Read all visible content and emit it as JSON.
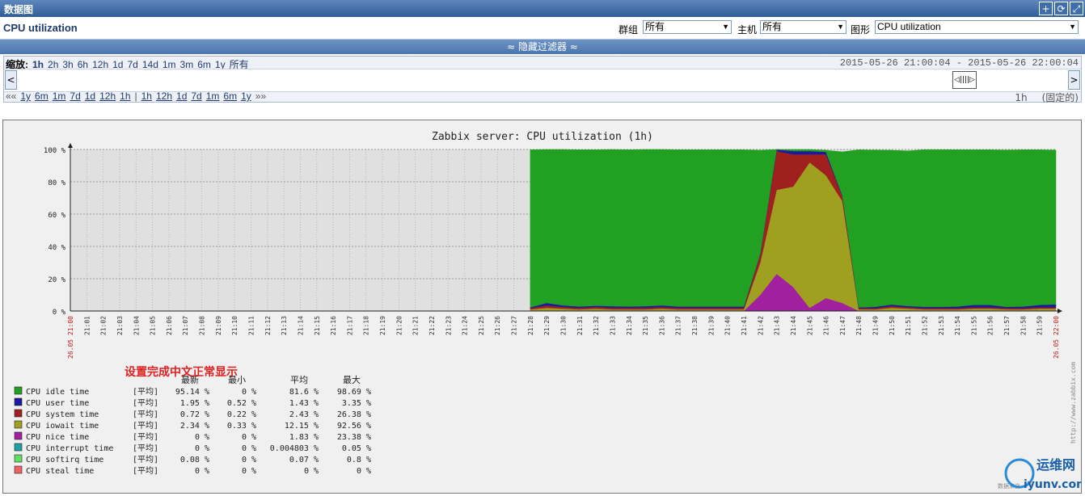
{
  "window": {
    "title": "数据图"
  },
  "header": {
    "page_title": "CPU utilization",
    "group_label": "群组",
    "group_value": "所有",
    "host_label": "主机",
    "host_value": "所有",
    "graph_label": "图形",
    "graph_value": "CPU utilization"
  },
  "filter_toggle": "≈ 隐藏过滤器 ≈",
  "zoom": {
    "label": "缩放:",
    "options": [
      "1h",
      "2h",
      "3h",
      "6h",
      "12h",
      "1d",
      "7d",
      "14d",
      "1m",
      "3m",
      "6m",
      "1y",
      "所有"
    ],
    "selected": "1h",
    "date_range": "2015-05-26 21:00:04  -  2015-05-26 22:00:04"
  },
  "nav": {
    "back_prefix": "««",
    "back": [
      "1y",
      "6m",
      "1m",
      "7d",
      "1d",
      "12h",
      "1h"
    ],
    "separator": "|",
    "forward": [
      "1h",
      "12h",
      "1d",
      "7d",
      "1m",
      "6m",
      "1y"
    ],
    "forward_suffix": "»»",
    "period": "1h",
    "fixed": "(固定的)"
  },
  "chart_data": {
    "type": "area",
    "title": "Zabbix server: CPU utilization (1h)",
    "ylim": [
      0,
      100
    ],
    "y_ticks": [
      "0 %",
      "20 %",
      "40 %",
      "60 %",
      "80 %",
      "100 %"
    ],
    "x": [
      "21:00",
      "21:01",
      "21:02",
      "21:03",
      "21:04",
      "21:05",
      "21:06",
      "21:07",
      "21:08",
      "21:09",
      "21:10",
      "21:11",
      "21:12",
      "21:13",
      "21:14",
      "21:15",
      "21:16",
      "21:17",
      "21:18",
      "21:19",
      "21:20",
      "21:21",
      "21:22",
      "21:23",
      "21:24",
      "21:25",
      "21:26",
      "21:27",
      "21:28",
      "21:29",
      "21:30",
      "21:31",
      "21:32",
      "21:33",
      "21:34",
      "21:35",
      "21:36",
      "21:37",
      "21:38",
      "21:39",
      "21:40",
      "21:41",
      "21:42",
      "21:43",
      "21:44",
      "21:45",
      "21:46",
      "21:47",
      "21:48",
      "21:49",
      "21:50",
      "21:51",
      "21:52",
      "21:53",
      "21:54",
      "21:55",
      "21:56",
      "21:57",
      "21:58",
      "21:59",
      "22:00"
    ],
    "start_label": "26.05 21:00",
    "end_label": "26.05 22:00",
    "grid": true,
    "data_start_index": 28,
    "series": [
      {
        "name": "CPU nice time",
        "color": "#a020a0",
        "values": [
          0,
          0,
          0,
          0,
          0,
          0,
          0,
          0,
          0,
          0,
          0,
          0,
          0,
          0,
          0,
          0,
          0,
          0,
          0,
          0,
          0,
          0,
          0,
          0,
          0,
          0,
          0,
          0,
          0,
          0,
          0,
          0,
          0,
          0,
          0,
          0,
          0,
          0,
          0,
          0,
          0,
          0,
          10,
          23,
          15,
          2,
          8,
          5,
          0,
          0,
          0,
          0,
          0,
          0,
          0,
          0,
          0,
          0,
          0,
          0,
          0
        ]
      },
      {
        "name": "CPU iowait time",
        "color": "#a0a020",
        "values": [
          0,
          0,
          0,
          0,
          0,
          0,
          0,
          0,
          0,
          0,
          0,
          0,
          0,
          0,
          0,
          0,
          0,
          0,
          0,
          0,
          0,
          0,
          0,
          0,
          0,
          0,
          0,
          0,
          1,
          2,
          1.5,
          1,
          1.5,
          1,
          1,
          1,
          1.5,
          1,
          1,
          1,
          1,
          1,
          20,
          52,
          62,
          90,
          76,
          63,
          1,
          1,
          2,
          1.5,
          1,
          1,
          1,
          1.5,
          1.5,
          1,
          1,
          1.5,
          1.5
        ]
      },
      {
        "name": "CPU system time",
        "color": "#a02020",
        "values": [
          0,
          0,
          0,
          0,
          0,
          0,
          0,
          0,
          0,
          0,
          0,
          0,
          0,
          0,
          0,
          0,
          0,
          0,
          0,
          0,
          0,
          0,
          0,
          0,
          0,
          0,
          0,
          0,
          0.8,
          1.5,
          1,
          1,
          1,
          1,
          1,
          1,
          1,
          1,
          1,
          1,
          1,
          1,
          5,
          24,
          20,
          5,
          13,
          3,
          0.8,
          0.8,
          1,
          0.8,
          0.8,
          0.8,
          0.8,
          0.8,
          0.8,
          0.8,
          0.8,
          0.8,
          0.8
        ]
      },
      {
        "name": "CPU user time",
        "color": "#1a1aa0",
        "values": [
          0,
          0,
          0,
          0,
          0,
          0,
          0,
          0,
          0,
          0,
          0,
          0,
          0,
          0,
          0,
          0,
          0,
          0,
          0,
          0,
          0,
          0,
          0,
          0,
          0,
          0,
          0,
          0,
          0.5,
          1.5,
          1,
          0.8,
          0.8,
          1,
          0.8,
          1,
          1,
          0.8,
          0.8,
          0.8,
          0.8,
          0.8,
          0.5,
          1,
          2,
          2,
          1.5,
          0.5,
          0.5,
          0.8,
          1,
          0.8,
          0.8,
          0.8,
          1,
          1.5,
          1.5,
          0.8,
          1,
          1.5,
          1.8
        ]
      },
      {
        "name": "CPU idle time",
        "color": "#22a022",
        "values": [
          0,
          0,
          0,
          0,
          0,
          0,
          0,
          0,
          0,
          0,
          0,
          0,
          0,
          0,
          0,
          0,
          0,
          0,
          0,
          0,
          0,
          0,
          0,
          0,
          0,
          0,
          0,
          0,
          97.5,
          95,
          96.5,
          97,
          96.5,
          97,
          97,
          97,
          96.5,
          97,
          97,
          97,
          97,
          97,
          64,
          0,
          1,
          1,
          1,
          27,
          97.5,
          97,
          95.5,
          96,
          97.3,
          97.3,
          97,
          96,
          96,
          97,
          97,
          96,
          95.5
        ]
      }
    ],
    "annotation": "设置完成中文正常显示",
    "legend_headers": [
      "最新",
      "最小",
      "平均",
      "最大"
    ],
    "legend": [
      {
        "name": "CPU idle time",
        "color": "#22a022",
        "func": "[平均]",
        "last": "95.14 %",
        "min": "0 %",
        "avg": "81.6 %",
        "max": "98.69 %"
      },
      {
        "name": "CPU user time",
        "color": "#1a1aa0",
        "func": "[平均]",
        "last": "1.95 %",
        "min": "0.52 %",
        "avg": "1.43 %",
        "max": "3.35 %"
      },
      {
        "name": "CPU system time",
        "color": "#a02020",
        "func": "[平均]",
        "last": "0.72 %",
        "min": "0.22 %",
        "avg": "2.43 %",
        "max": "26.38 %"
      },
      {
        "name": "CPU iowait time",
        "color": "#a0a020",
        "func": "[平均]",
        "last": "2.34 %",
        "min": "0.33 %",
        "avg": "12.15 %",
        "max": "92.56 %"
      },
      {
        "name": "CPU nice time",
        "color": "#a020a0",
        "func": "[平均]",
        "last": "0 %",
        "min": "0 %",
        "avg": "1.83 %",
        "max": "23.38 %"
      },
      {
        "name": "CPU interrupt time",
        "color": "#20a0a0",
        "func": "[平均]",
        "last": "0 %",
        "min": "0 %",
        "avg": "0.004803 %",
        "max": "0.05 %"
      },
      {
        "name": "CPU softirq time",
        "color": "#60e060",
        "func": "[平均]",
        "last": "0.08 %",
        "min": "0 %",
        "avg": "0.07 %",
        "max": "0.8 %"
      },
      {
        "name": "CPU steal time",
        "color": "#f06060",
        "func": "[平均]",
        "last": "0 %",
        "min": "0 %",
        "avg": "0 %",
        "max": "0 %"
      }
    ],
    "watermark": "http://www.zabbix.com",
    "footer_note": "数据来自",
    "logo_text": "运维网",
    "logo_url_text": "iyunv.com"
  }
}
